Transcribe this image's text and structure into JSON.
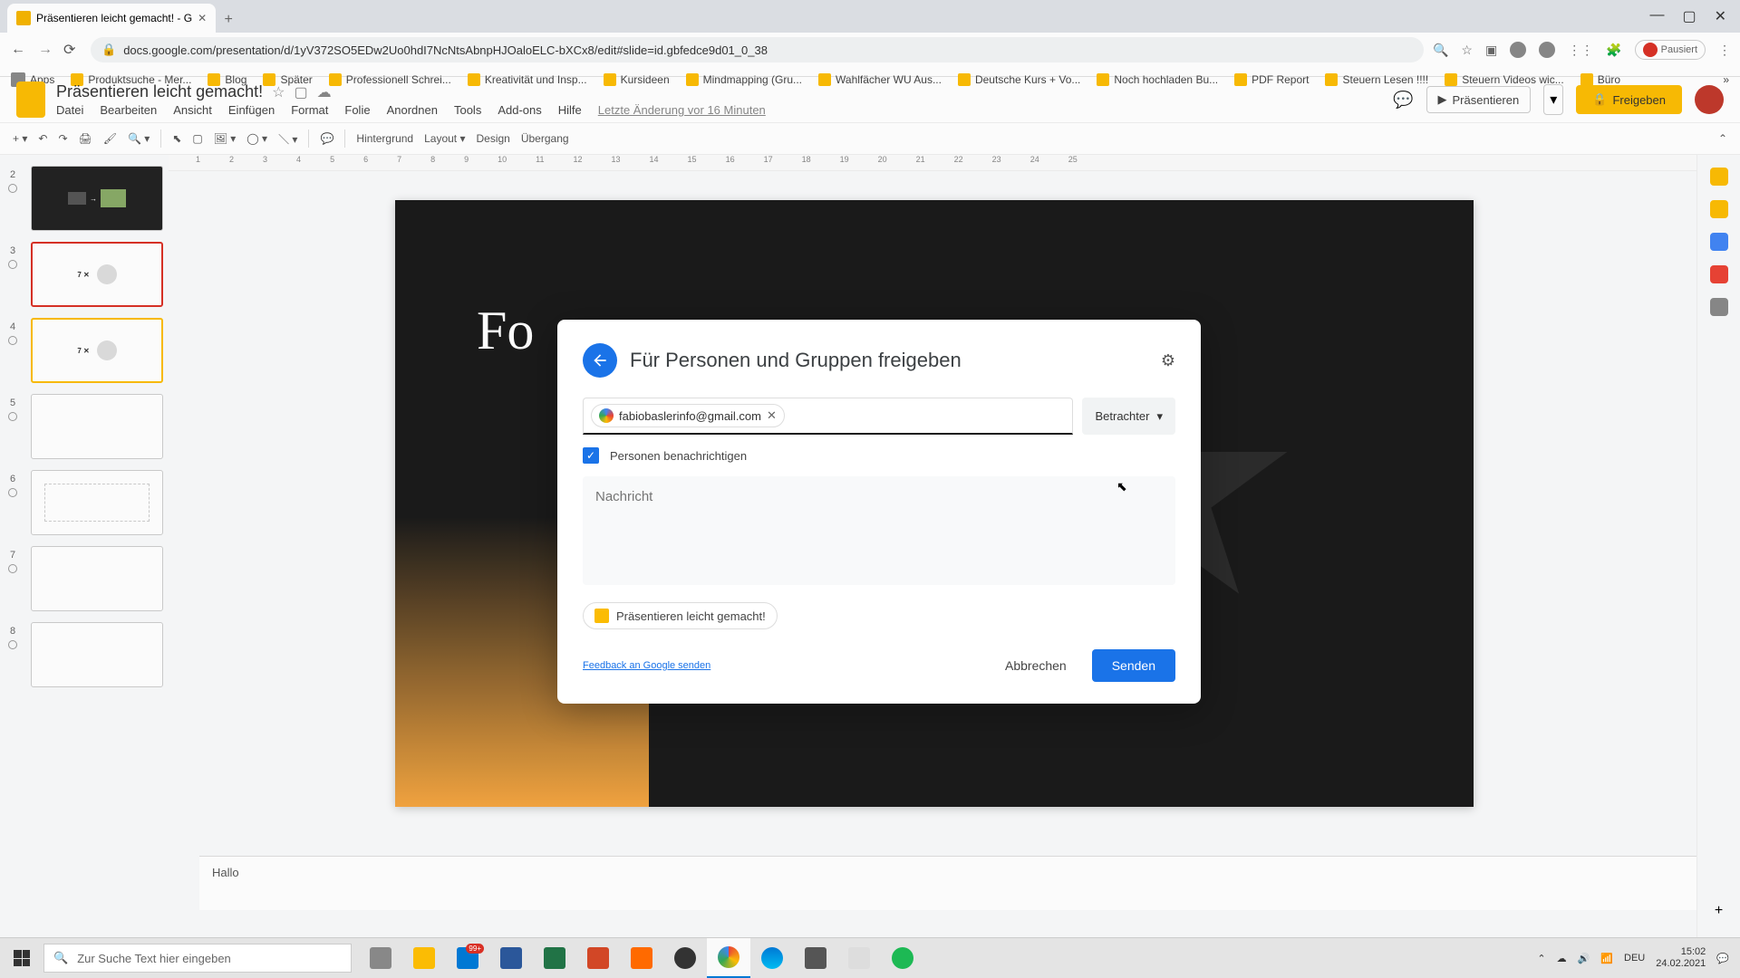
{
  "browser": {
    "tab_title": "Präsentieren leicht gemacht! - G",
    "url": "docs.google.com/presentation/d/1yV372SO5EDw2Uo0hdI7NcNtsAbnpHJOaloELC-bXCx8/edit#slide=id.gbfedce9d01_0_38",
    "pause_label": "Pausiert"
  },
  "bookmarks": {
    "apps": "Apps",
    "items": [
      "Produktsuche - Mer...",
      "Blog",
      "Später",
      "Professionell Schrei...",
      "Kreativität und Insp...",
      "Kursideen",
      "Mindmapping (Gru...",
      "Wahlfächer WU Aus...",
      "Deutsche Kurs + Vo...",
      "Noch hochladen Bu...",
      "PDF Report",
      "Steuern Lesen !!!!",
      "Steuern Videos wic...",
      "Büro"
    ]
  },
  "doc": {
    "title": "Präsentieren leicht gemacht!",
    "last_edit": "Letzte Änderung vor 16 Minuten"
  },
  "menu": {
    "file": "Datei",
    "edit": "Bearbeiten",
    "view": "Ansicht",
    "insert": "Einfügen",
    "format": "Format",
    "slide": "Folie",
    "arrange": "Anordnen",
    "tools": "Tools",
    "addons": "Add-ons",
    "help": "Hilfe"
  },
  "header": {
    "present": "Präsentieren",
    "share": "Freigeben"
  },
  "toolbar": {
    "background": "Hintergrund",
    "layout": "Layout",
    "design": "Design",
    "transition": "Übergang"
  },
  "ruler": [
    "1",
    "2",
    "3",
    "4",
    "5",
    "6",
    "7",
    "8",
    "9",
    "10",
    "11",
    "12",
    "13",
    "14",
    "15",
    "16",
    "17",
    "18",
    "19",
    "20",
    "21",
    "22",
    "23",
    "24",
    "25"
  ],
  "slide": {
    "visible_title": "Fo"
  },
  "notes": {
    "text": "Hallo"
  },
  "dialog": {
    "title": "Für Personen und Gruppen freigeben",
    "email": "fabiobaslerinfo@gmail.com",
    "role": "Betrachter",
    "notify": "Personen benachrichtigen",
    "message_placeholder": "Nachricht",
    "attachment": "Präsentieren leicht gemacht!",
    "feedback": "Feedback an Google senden",
    "cancel": "Abbrechen",
    "send": "Senden"
  },
  "taskbar": {
    "search_placeholder": "Zur Suche Text hier eingeben",
    "lang": "DEU",
    "time": "15:02",
    "date": "24.02.2021",
    "notif_count": "99+"
  },
  "thumbs": {
    "t3": "7 ✕",
    "t4": "7 ✕"
  }
}
